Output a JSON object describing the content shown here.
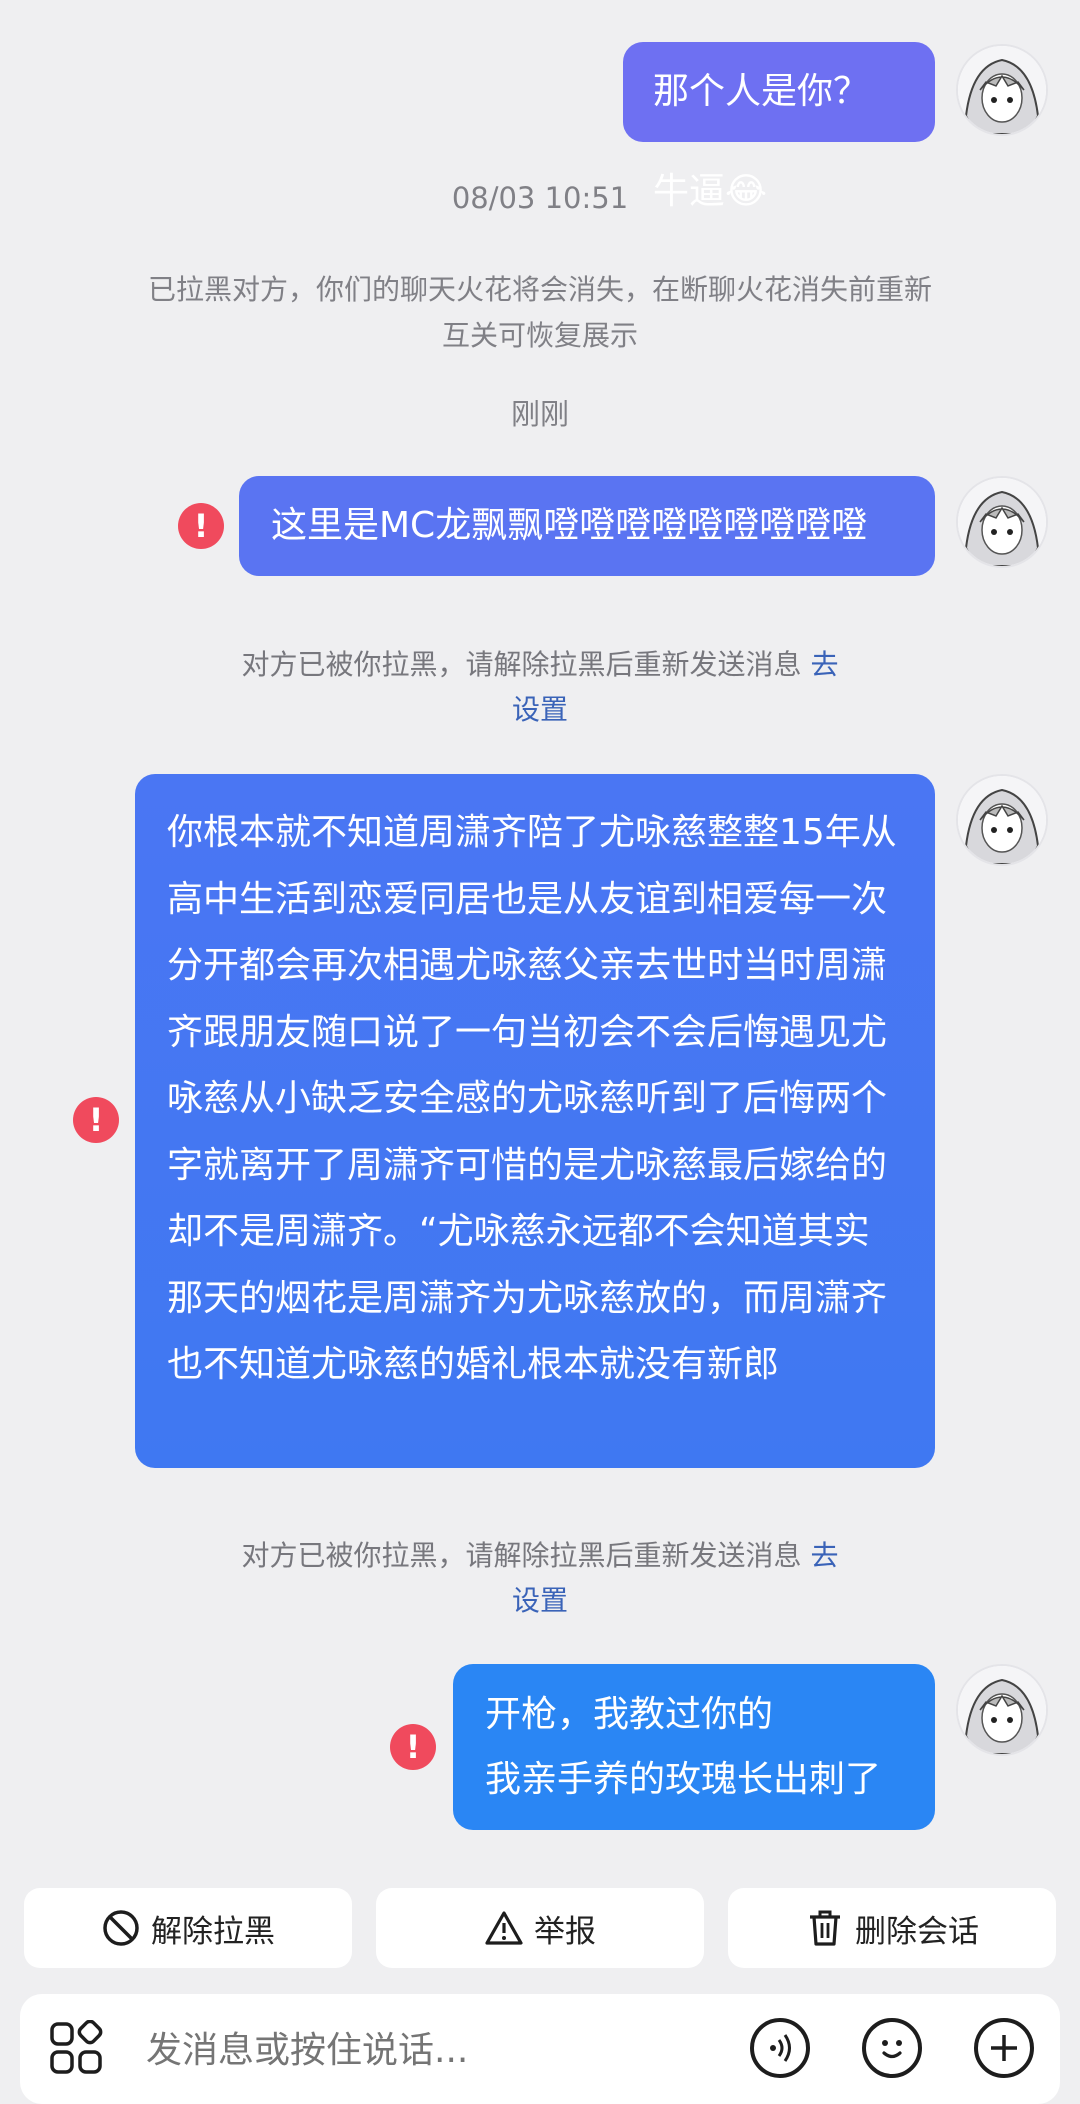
{
  "messages": [
    {
      "text": "那个人是你？ 牛逼😂",
      "failed": false
    },
    {
      "text": "这里是MC龙飘飘噔噔噔噔噔噔噔噔噔",
      "failed": true
    },
    {
      "text": "你根本就不知道周潇齐陪了尤咏慈整整15年从高中生活到恋爱同居也是从友谊到相爱每一次分开都会再次相遇尤咏慈父亲去世时当时周潇齐跟朋友随口说了一句当初会不会后悔遇见尤咏慈从小缺乏安全感的尤咏慈听到了后悔两个字就离开了周潇齐可惜的是尤咏慈最后嫁给的却不是周潇齐。“尤咏慈永远都不会知道其实那天的烟花是周潇齐为尤咏慈放的，而周潇齐也不知道尤咏慈的婚礼根本就没有新郎",
      "failed": true
    },
    {
      "line1": "开枪，我教过你的",
      "line2": "我亲手养的玫瑰长出刺了",
      "failed": true
    }
  ],
  "timestamp": "08/03 10:51",
  "block_notice": {
    "line1": "已拉黑对方，你们的聊天火花将会消失，在断聊火花消失前重新",
    "line2": "互关可恢复展示"
  },
  "just_now": "刚刚",
  "send_fail_notice": {
    "text": "对方已被你拉黑，请解除拉黑后重新发送消息 ",
    "link_part1": "去",
    "link_part2": "设置"
  },
  "actions": {
    "unblock": "解除拉黑",
    "report": "举报",
    "delete": "删除会话"
  },
  "input": {
    "placeholder": "发消息或按住说话..."
  },
  "icons": {
    "error": "exclamation-circle-icon",
    "unblock": "prohibit-icon",
    "report": "warning-triangle-icon",
    "delete": "trash-icon",
    "apps": "apps-grid-icon",
    "voice": "voice-wave-icon",
    "emoji": "emoji-face-icon",
    "plus": "plus-circle-icon"
  },
  "colors": {
    "bubble_1": "#6e70f2",
    "bubble_2": "#5a74f2",
    "bubble_3": "#3f78f2",
    "bubble_4": "#2a86f4",
    "error": "#f04a5d",
    "link": "#3a63b8",
    "background": "#efeff1"
  }
}
